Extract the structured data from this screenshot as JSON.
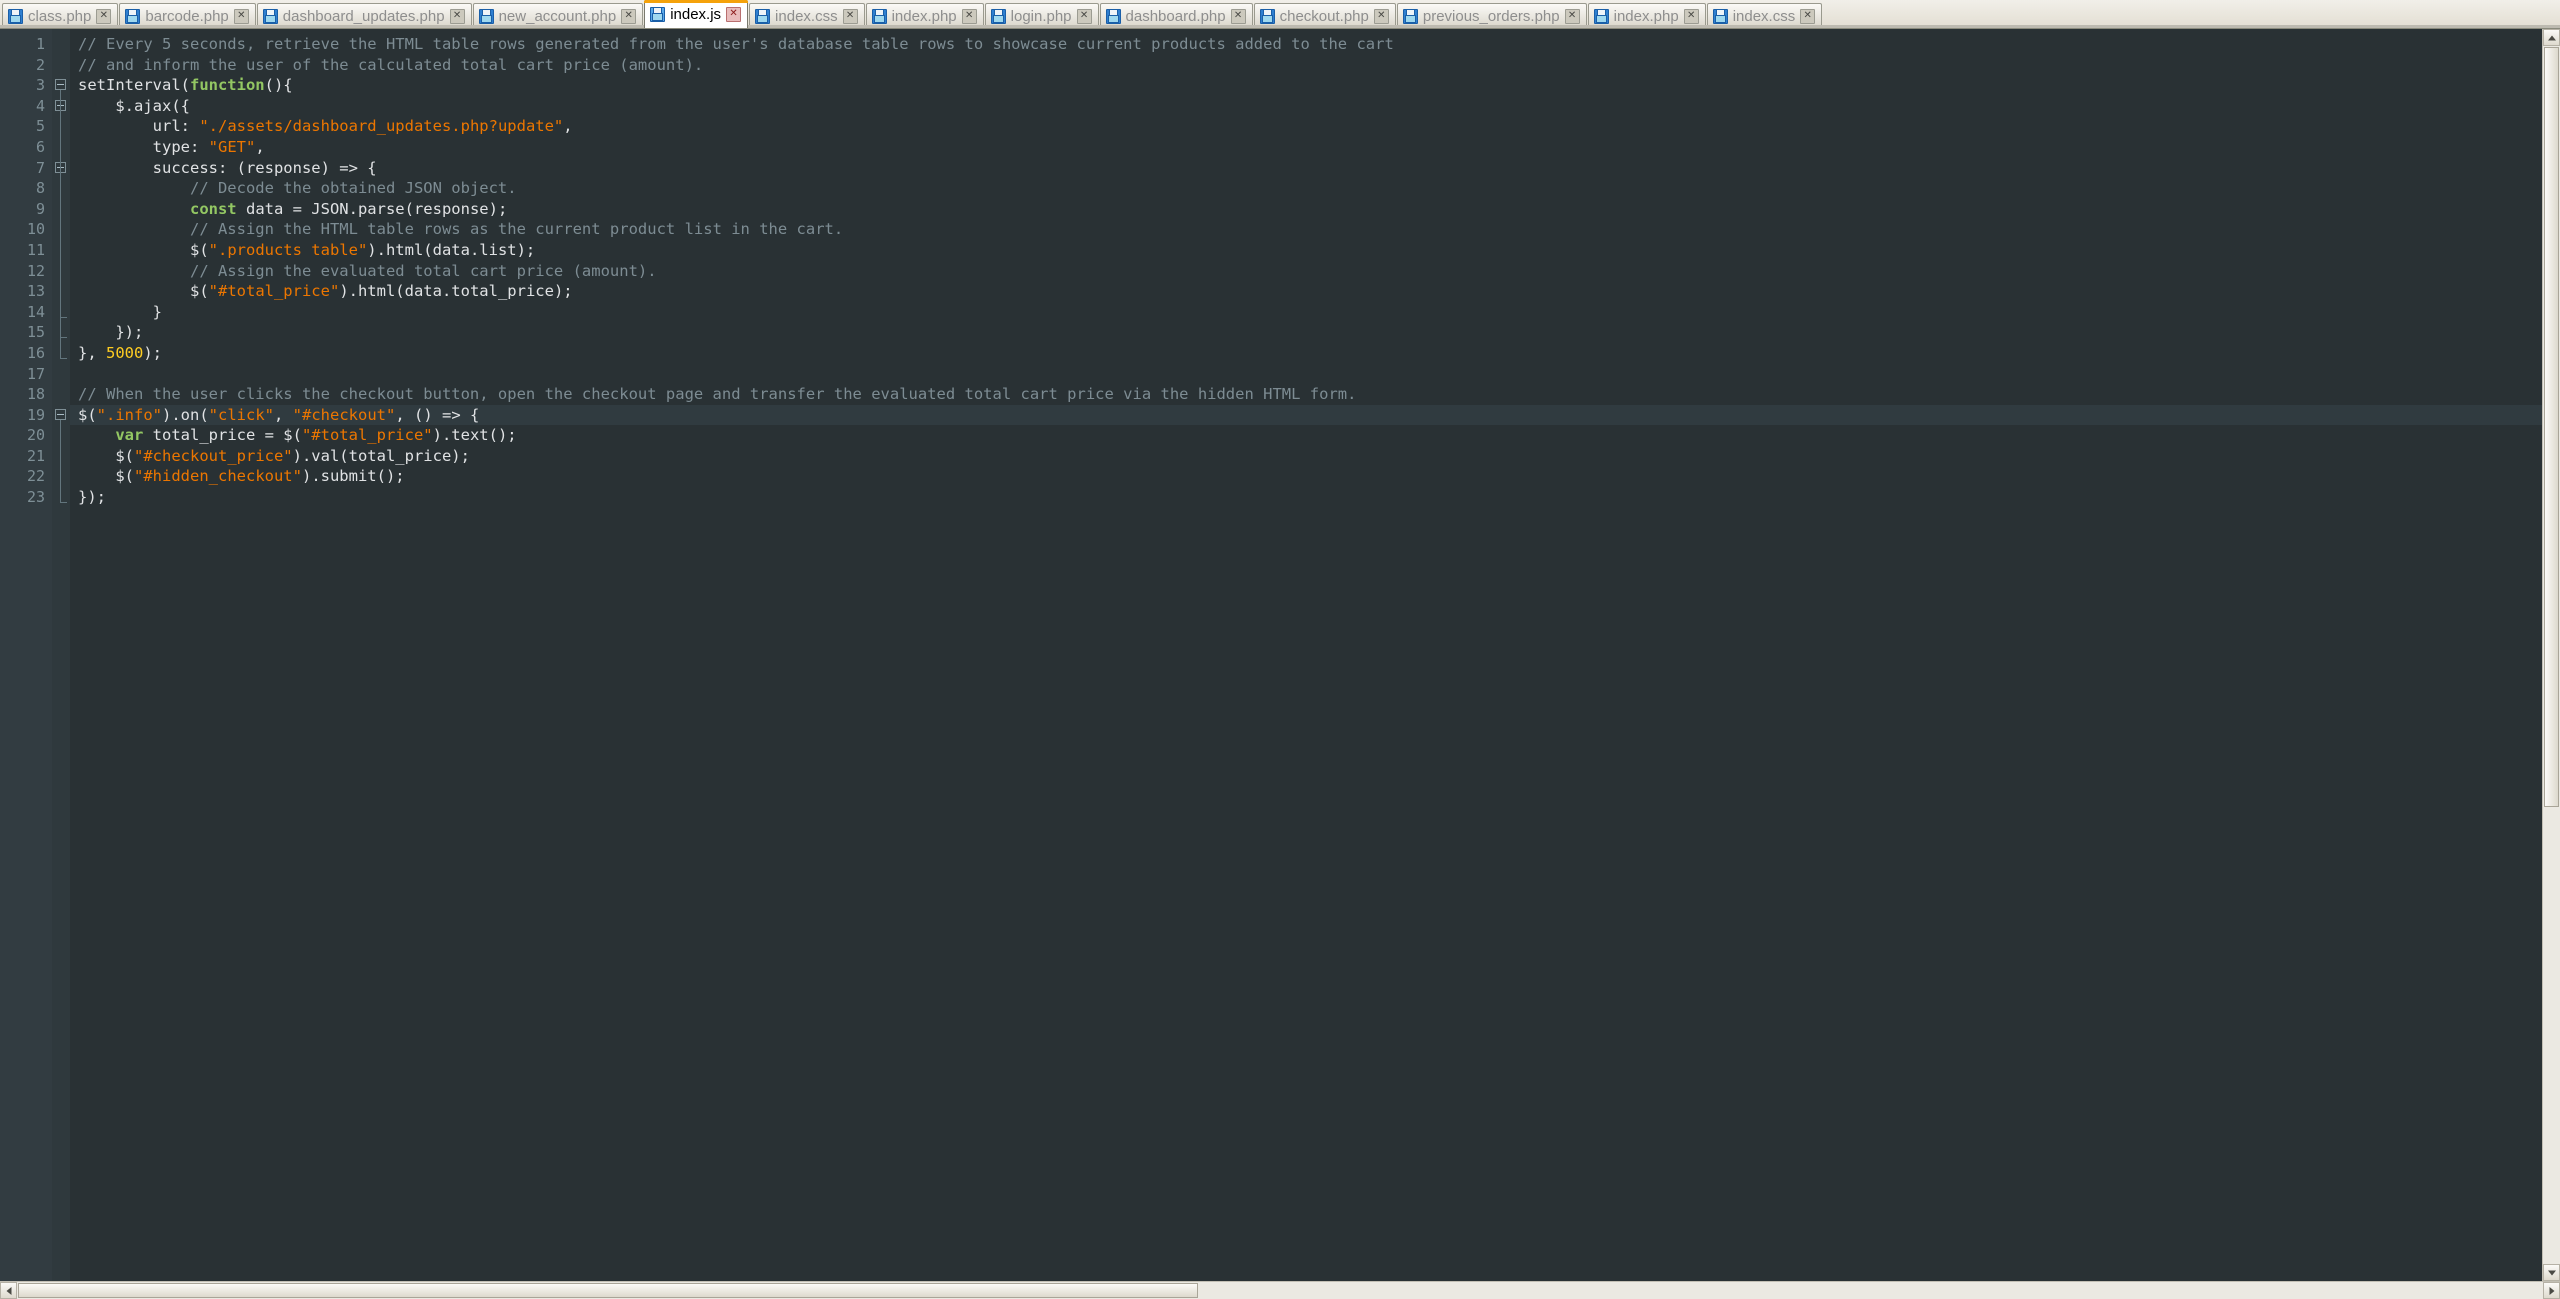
{
  "window": {
    "title": "index.js",
    "theme": "dark",
    "editor_background": "#293134",
    "gutter_background": "#323c41",
    "active_tab_accent": "#f5a20a"
  },
  "tabbar": {
    "tabs": [
      {
        "label": "class.php",
        "active": false,
        "icon": "save-file-icon",
        "close_label": "✕"
      },
      {
        "label": "barcode.php",
        "active": false,
        "icon": "save-file-icon",
        "close_label": "✕"
      },
      {
        "label": "dashboard_updates.php",
        "active": false,
        "icon": "save-file-icon",
        "close_label": "✕"
      },
      {
        "label": "new_account.php",
        "active": false,
        "icon": "save-file-icon",
        "close_label": "✕"
      },
      {
        "label": "index.js",
        "active": true,
        "icon": "save-file-icon",
        "close_label": "✕"
      },
      {
        "label": "index.css",
        "active": false,
        "icon": "save-file-icon",
        "close_label": "✕"
      },
      {
        "label": "index.php",
        "active": false,
        "icon": "save-file-icon",
        "close_label": "✕"
      },
      {
        "label": "login.php",
        "active": false,
        "icon": "save-file-icon",
        "close_label": "✕"
      },
      {
        "label": "dashboard.php",
        "active": false,
        "icon": "save-file-icon",
        "close_label": "✕"
      },
      {
        "label": "checkout.php",
        "active": false,
        "icon": "save-file-icon",
        "close_label": "✕"
      },
      {
        "label": "previous_orders.php",
        "active": false,
        "icon": "save-file-icon",
        "close_label": "✕"
      },
      {
        "label": "index.php",
        "active": false,
        "icon": "save-file-icon",
        "close_label": "✕"
      },
      {
        "label": "index.css",
        "active": false,
        "icon": "save-file-icon",
        "close_label": "✕"
      }
    ]
  },
  "editor": {
    "language": "javascript",
    "current_line": 19,
    "total_lines": 23,
    "line_numbers": [
      1,
      2,
      3,
      4,
      5,
      6,
      7,
      8,
      9,
      10,
      11,
      12,
      13,
      14,
      15,
      16,
      17,
      18,
      19,
      20,
      21,
      22,
      23
    ],
    "lines": [
      {
        "n": 1,
        "indent": 0,
        "tokens": [
          {
            "t": "// Every 5 seconds, retrieve the HTML table rows generated from the user's database table rows to showcase current products added to the cart",
            "c": "cm"
          }
        ]
      },
      {
        "n": 2,
        "indent": 0,
        "tokens": [
          {
            "t": "// and inform the user of the calculated total cart price (amount).",
            "c": "cm"
          }
        ]
      },
      {
        "n": 3,
        "indent": 0,
        "fold": "open",
        "tokens": [
          {
            "t": "setInterval(",
            "c": "pl"
          },
          {
            "t": "function",
            "c": "kw"
          },
          {
            "t": "(){",
            "c": "pl"
          }
        ]
      },
      {
        "n": 4,
        "indent": 1,
        "fold": "open",
        "tokens": [
          {
            "t": "$.ajax({",
            "c": "pl"
          }
        ]
      },
      {
        "n": 5,
        "indent": 2,
        "tokens": [
          {
            "t": "url: ",
            "c": "pl"
          },
          {
            "t": "\"./assets/dashboard_updates.php?update\"",
            "c": "st"
          },
          {
            "t": ",",
            "c": "pl"
          }
        ]
      },
      {
        "n": 6,
        "indent": 2,
        "tokens": [
          {
            "t": "type: ",
            "c": "pl"
          },
          {
            "t": "\"GET\"",
            "c": "st"
          },
          {
            "t": ",",
            "c": "pl"
          }
        ]
      },
      {
        "n": 7,
        "indent": 2,
        "fold": "open",
        "tokens": [
          {
            "t": "success: (response) => {",
            "c": "pl"
          }
        ]
      },
      {
        "n": 8,
        "indent": 3,
        "tokens": [
          {
            "t": "// Decode the obtained JSON object.",
            "c": "cm"
          }
        ]
      },
      {
        "n": 9,
        "indent": 3,
        "tokens": [
          {
            "t": "const",
            "c": "kw"
          },
          {
            "t": " data = JSON.parse(response);",
            "c": "pl"
          }
        ]
      },
      {
        "n": 10,
        "indent": 3,
        "tokens": [
          {
            "t": "// Assign the HTML table rows as the current product list in the cart.",
            "c": "cm"
          }
        ]
      },
      {
        "n": 11,
        "indent": 3,
        "tokens": [
          {
            "t": "$(",
            "c": "pl"
          },
          {
            "t": "\".products table\"",
            "c": "st"
          },
          {
            "t": ").html(data.list);",
            "c": "pl"
          }
        ]
      },
      {
        "n": 12,
        "indent": 3,
        "tokens": [
          {
            "t": "// Assign the evaluated total cart price (amount).",
            "c": "cm"
          }
        ]
      },
      {
        "n": 13,
        "indent": 3,
        "tokens": [
          {
            "t": "$(",
            "c": "pl"
          },
          {
            "t": "\"#total_price\"",
            "c": "st"
          },
          {
            "t": ").html(data.total_price);",
            "c": "pl"
          }
        ]
      },
      {
        "n": 14,
        "indent": 2,
        "fold": "end",
        "tokens": [
          {
            "t": "}",
            "c": "pl"
          }
        ]
      },
      {
        "n": 15,
        "indent": 1,
        "fold": "end",
        "tokens": [
          {
            "t": "});",
            "c": "pl"
          }
        ]
      },
      {
        "n": 16,
        "indent": 0,
        "fold": "end",
        "tokens": [
          {
            "t": "}, ",
            "c": "pl"
          },
          {
            "t": "5000",
            "c": "num"
          },
          {
            "t": ");",
            "c": "pl"
          }
        ]
      },
      {
        "n": 17,
        "indent": 0,
        "tokens": []
      },
      {
        "n": 18,
        "indent": 0,
        "tokens": [
          {
            "t": "// When the user clicks the checkout button, open the checkout page and transfer the evaluated total cart price via the hidden HTML form.",
            "c": "cm"
          }
        ]
      },
      {
        "n": 19,
        "indent": 0,
        "fold": "open",
        "current": true,
        "tokens": [
          {
            "t": "$(",
            "c": "pl"
          },
          {
            "t": "\".info\"",
            "c": "st"
          },
          {
            "t": ").on(",
            "c": "pl"
          },
          {
            "t": "\"click\"",
            "c": "st"
          },
          {
            "t": ", ",
            "c": "pl"
          },
          {
            "t": "\"#checkout\"",
            "c": "st"
          },
          {
            "t": ", () => {",
            "c": "pl"
          }
        ]
      },
      {
        "n": 20,
        "indent": 1,
        "tokens": [
          {
            "t": "var",
            "c": "kw"
          },
          {
            "t": " total_price = $(",
            "c": "pl"
          },
          {
            "t": "\"#total_price\"",
            "c": "st"
          },
          {
            "t": ").text();",
            "c": "pl"
          }
        ]
      },
      {
        "n": 21,
        "indent": 1,
        "tokens": [
          {
            "t": "$(",
            "c": "pl"
          },
          {
            "t": "\"#checkout_price\"",
            "c": "st"
          },
          {
            "t": ").val(total_price);",
            "c": "pl"
          }
        ]
      },
      {
        "n": 22,
        "indent": 1,
        "tokens": [
          {
            "t": "$(",
            "c": "pl"
          },
          {
            "t": "\"#hidden_checkout\"",
            "c": "st"
          },
          {
            "t": ").submit();",
            "c": "pl"
          }
        ]
      },
      {
        "n": 23,
        "indent": 0,
        "fold": "end",
        "tokens": [
          {
            "t": "});",
            "c": "pl"
          }
        ]
      }
    ]
  },
  "scrollbars": {
    "vertical": {
      "up_arrow": "▲",
      "down_arrow": "▼"
    },
    "horizontal": {
      "left_arrow": "◀",
      "right_arrow": "▶"
    }
  }
}
